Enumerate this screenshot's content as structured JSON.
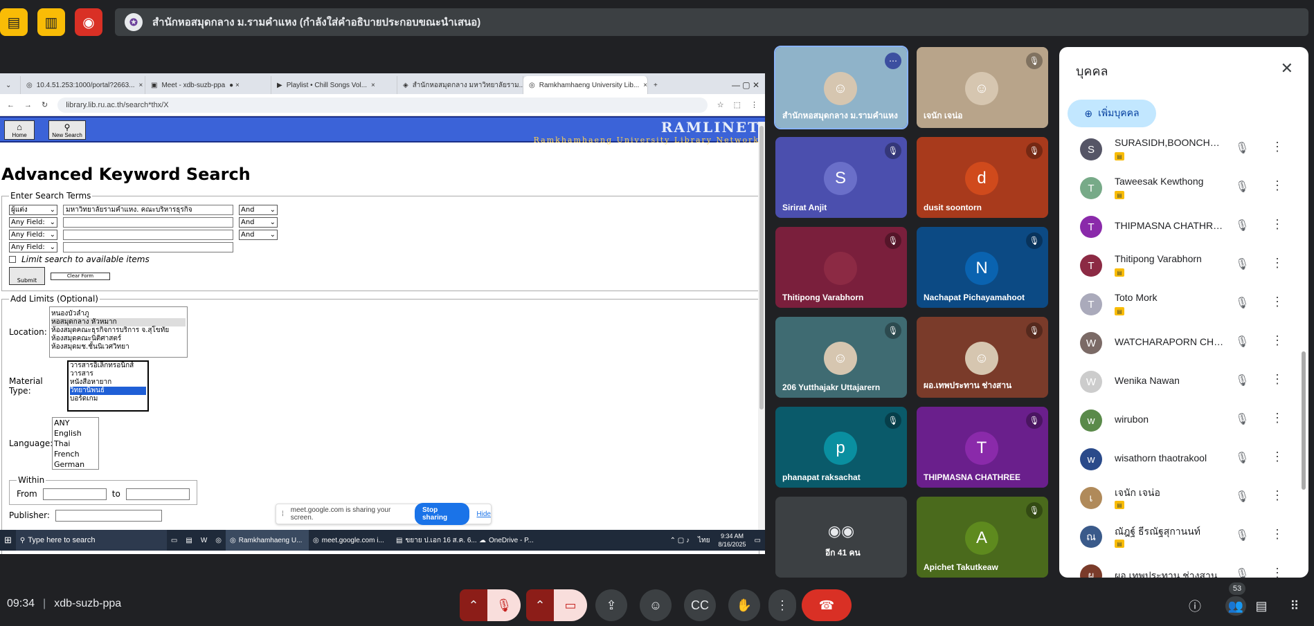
{
  "top": {
    "presenter_text": "สำนักหอสมุดกลาง ม.รามคำแหง (กำลังใส่คำอธิบายประกอบขณะนำเสนอ)"
  },
  "browser": {
    "tabs": [
      "10.4.51.253:1000/portal?2663...",
      "Meet - xdb-suzb-ppa",
      "Playlist • Chill Songs Vol...",
      "สำนักหอสมุดกลาง มหาวิทยาลัยราม...",
      "Ramkhamhaeng University Lib..."
    ],
    "url": "library.lib.ru.ac.th/search*thx/X"
  },
  "banner": {
    "home": "Home",
    "new_search": "New Search",
    "brand": "RAMLINET",
    "sub": "Ramkhamhaeng University Library Network"
  },
  "search": {
    "title": "Advanced Keyword Search",
    "terms_legend": "Enter Search Terms",
    "rows": [
      {
        "field": "ผู้แต่ง",
        "value": "มหาวิทยาลัยรามคำแหง. คณะบริหารธุรกิจ",
        "op": "And"
      },
      {
        "field": "Any Field:",
        "value": "",
        "op": "And"
      },
      {
        "field": "Any Field:",
        "value": "",
        "op": "And"
      },
      {
        "field": "Any Field:",
        "value": ""
      }
    ],
    "limit_label": "Limit search to available items",
    "submit": "Submit",
    "clear": "Clear Form",
    "limits_legend": "Add Limits (Optional)",
    "location_label": "Location:",
    "locations": [
      "หนองบัวลำภู",
      "หอสมุดกลาง หัวหมาก",
      "ห้องสมุดคณะธุรกิจการบริการ จ.สุโขทัย",
      "ห้องสมุดคณะนิติศาสตร์",
      "ห้องสมุดมช.ชั้นนิเวศวิทยา"
    ],
    "material_label": "Material Type:",
    "materials": [
      "วารสารอิเล็กทรอนิกส์",
      "วารสาร",
      "หนังสือหายาก",
      "วิทยานิพนธ์",
      "บอร์ดเกม"
    ],
    "language_label": "Language:",
    "languages": [
      "ANY",
      "English",
      "Thai",
      "French",
      "German"
    ],
    "within": "Within",
    "from": "From",
    "to": "to",
    "publisher": "Publisher:"
  },
  "sharebar": {
    "text": "meet.google.com is sharing your screen.",
    "stop": "Stop sharing",
    "hide": "Hide"
  },
  "taskbar": {
    "search": "Type here to search",
    "items": [
      "Ramkhamhaeng U...",
      "meet.google.com i...",
      "ขยาย ป.เอก 16 ส.ค. 6...",
      "OneDrive - P..."
    ],
    "lang": "ไทย",
    "time": "9:34 AM",
    "date": "8/16/2025"
  },
  "tiles": [
    {
      "name": "สำนักหอสมุดกลาง ม.รามคำแหง",
      "color": "#8fb3c9",
      "photo": true
    },
    {
      "name": "เจนัก เจน่อ",
      "color": "#b8a48a",
      "photo": true
    },
    {
      "name": "Sirirat Anjit",
      "color": "#4b4fae",
      "initial": "S",
      "avcolor": "#6a6fc9"
    },
    {
      "name": "dusit soontorn",
      "color": "#a83a1c",
      "initial": "d",
      "avcolor": "#d04a1c"
    },
    {
      "name": "Thitipong Varabhorn",
      "color": "#7a1f3c",
      "initial": "",
      "avcolor": "#8c2a44"
    },
    {
      "name": "Nachapat Pichayamahoot",
      "color": "#0c4a84",
      "initial": "N",
      "avcolor": "#0a63b0"
    },
    {
      "name": "206 Yutthajakr Uttajarern",
      "color": "#3f6b72",
      "photo": true
    },
    {
      "name": "ผอ.เทพประทาน ช่างสาน",
      "color": "#7a3b2a",
      "photo": true
    },
    {
      "name": "phanapat raksachat",
      "color": "#0a5a6a",
      "initial": "p",
      "avcolor": "#0a8fa0"
    },
    {
      "name": "THIPMASNA CHATHREE",
      "color": "#6a1f8c",
      "initial": "T",
      "avcolor": "#8a2aaa"
    },
    {
      "name": "อีก 41 คน",
      "color": "#3c4043",
      "others": true
    },
    {
      "name": "Apichet Takutkeaw",
      "color": "#4a6a1c",
      "initial": "A",
      "avcolor": "#5e8a1e"
    }
  ],
  "people": {
    "title": "บุคคล",
    "add": "เพิ่มบุคคล",
    "count": "53",
    "list": [
      {
        "name": "SURASIDH,BOONCHUN...",
        "initial": "S",
        "color": "#556"
      },
      {
        "name": "Taweesak Kewthong",
        "initial": "T",
        "color": "#7a8"
      },
      {
        "name": "THIPMASNA CHATHREE",
        "initial": "T",
        "color": "#8a2aaa"
      },
      {
        "name": "Thitipong Varabhorn",
        "initial": "T",
        "color": "#8c2a44"
      },
      {
        "name": "Toto Mork",
        "initial": "T",
        "color": "#aab"
      },
      {
        "name": "WATCHARAPORN CHO...",
        "initial": "W",
        "color": "#7b6a66"
      },
      {
        "name": "Wenika Nawan",
        "initial": "W",
        "color": "#ccc"
      },
      {
        "name": "wirubon",
        "initial": "w",
        "color": "#5a8a4a"
      },
      {
        "name": "wisathorn thaotrakool",
        "initial": "w",
        "color": "#2a4a8a"
      },
      {
        "name": "เจนัก เจน่อ",
        "initial": "เ",
        "color": "#b08a5a"
      },
      {
        "name": "ณัฎฐ์ ธีรณัฐสุกานนท์",
        "initial": "ณ",
        "color": "#3a5a8a"
      },
      {
        "name": "ผอ.เทพประทาน ช่างสาน",
        "initial": "ผ",
        "color": "#7a3b2a"
      }
    ]
  },
  "bottom": {
    "time": "09:34",
    "code": "xdb-suzb-ppa"
  }
}
